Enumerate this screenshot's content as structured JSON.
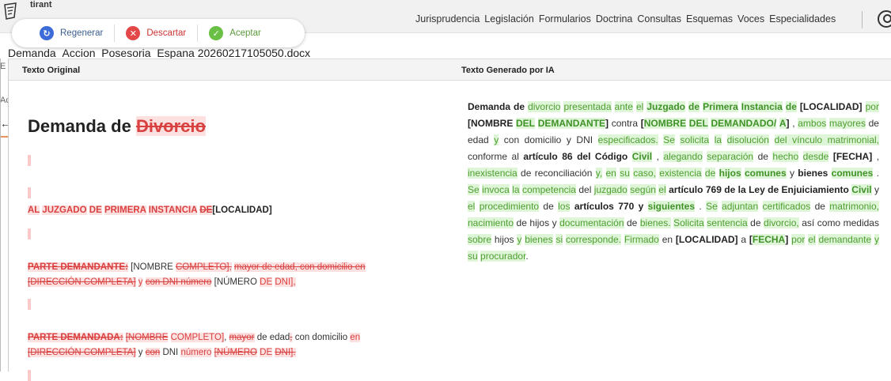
{
  "app": {
    "brand": "tirant",
    "nav": [
      "Jurisprudencia",
      "Legislación",
      "Formularios",
      "Doctrina",
      "Consultas",
      "Esquemas",
      "Voces",
      "Especialidades"
    ],
    "filename": "Demanda_Accion_Posesoria_Espana 20260217105050.docx",
    "side_fragments": [
      "E",
      "Ac"
    ]
  },
  "actions": {
    "regenerar": "Regenerar",
    "descartar": "Descartar",
    "aceptar": "Aceptar"
  },
  "compare": {
    "left_header": "Texto Original",
    "right_header": "Texto Generado por IA"
  },
  "original": {
    "title_prefix": "Demanda de ",
    "title_deleted": "Divorcio",
    "heading": {
      "deleted": [
        "AL",
        "JUZGADO",
        "DE",
        "PRIMERA",
        "INSTANCIA",
        "DE"
      ],
      "kept": "[LOCALIDAD]"
    },
    "parte_demandante": {
      "label": "PARTE DEMANDANTE:",
      "nombre": "[NOMBRE",
      "completo": "COMPLETO],",
      "mayor": "mayor de edad, con domicilio en",
      "direccion": "[DIRECCIÓN COMPLETA]",
      "y": "y",
      "con_dni": "con DNI número",
      "numero": "[NÚMERO",
      "de": "DE",
      "dni": "DNI],"
    },
    "parte_demandada": {
      "label": "PARTE DEMANDADA:",
      "nombre": "[NOMBRE",
      "completo": "COMPLETO]",
      "comma": ",",
      "mayor": "mayor",
      "de_edad": "de edad",
      "con_domicilio": "con domicilio",
      "en": "en",
      "direccion": "[DIRECCIÓN COMPLETA]",
      "y": "y",
      "con": "con",
      "dni_word": "DNI",
      "numero": "número",
      "numero2": "[NÚMERO",
      "de": "DE",
      "dni": "DNI]."
    }
  },
  "generated": {
    "text_tokens": [
      {
        "t": "Demanda de ",
        "k": "b"
      },
      {
        "t": "divorcio",
        "k": "ins"
      },
      {
        "t": " ",
        "k": "n"
      },
      {
        "t": "presentada",
        "k": "ins"
      },
      {
        "t": " ",
        "k": "n"
      },
      {
        "t": "ante",
        "k": "ins"
      },
      {
        "t": " ",
        "k": "n"
      },
      {
        "t": "el",
        "k": "ins"
      },
      {
        "t": " ",
        "k": "n"
      },
      {
        "t": "Juzgado",
        "k": "insb"
      },
      {
        "t": " ",
        "k": "n"
      },
      {
        "t": "de",
        "k": "insb"
      },
      {
        "t": " ",
        "k": "n"
      },
      {
        "t": "Primera",
        "k": "insb"
      },
      {
        "t": " ",
        "k": "n"
      },
      {
        "t": "Instancia",
        "k": "insb"
      },
      {
        "t": " ",
        "k": "n"
      },
      {
        "t": "de",
        "k": "insb"
      },
      {
        "t": " ",
        "k": "n"
      },
      {
        "t": "[LOCALIDAD]",
        "k": "b"
      },
      {
        "t": " ",
        "k": "n"
      },
      {
        "t": "por",
        "k": "ins"
      },
      {
        "t": " ",
        "k": "n"
      },
      {
        "t": "[NOMBRE",
        "k": "b"
      },
      {
        "t": " ",
        "k": "n"
      },
      {
        "t": "DEL",
        "k": "insb"
      },
      {
        "t": " ",
        "k": "n"
      },
      {
        "t": "DEMANDANTE",
        "k": "insb"
      },
      {
        "t": "]",
        "k": "b"
      },
      {
        "t": " contra ",
        "k": "n"
      },
      {
        "t": "[",
        "k": "b"
      },
      {
        "t": "NOMBRE",
        "k": "insb"
      },
      {
        "t": " ",
        "k": "n"
      },
      {
        "t": "DEL",
        "k": "insb"
      },
      {
        "t": " ",
        "k": "n"
      },
      {
        "t": "DEMANDADO/",
        "k": "insb"
      },
      {
        "t": " ",
        "k": "n"
      },
      {
        "t": "A",
        "k": "insb"
      },
      {
        "t": "]",
        "k": "b"
      },
      {
        "t": " , ",
        "k": "n"
      },
      {
        "t": "ambos",
        "k": "ins"
      },
      {
        "t": " ",
        "k": "n"
      },
      {
        "t": "mayores",
        "k": "ins"
      },
      {
        "t": " de edad ",
        "k": "n"
      },
      {
        "t": "y",
        "k": "ins"
      },
      {
        "t": " con domicilio y DNI ",
        "k": "n"
      },
      {
        "t": "especificados.",
        "k": "ins"
      },
      {
        "t": " ",
        "k": "n"
      },
      {
        "t": "Se",
        "k": "ins"
      },
      {
        "t": " ",
        "k": "n"
      },
      {
        "t": "solicita",
        "k": "ins"
      },
      {
        "t": " ",
        "k": "n"
      },
      {
        "t": "la",
        "k": "ins"
      },
      {
        "t": " ",
        "k": "n"
      },
      {
        "t": "disolución",
        "k": "ins"
      },
      {
        "t": " ",
        "k": "n"
      },
      {
        "t": "del vínculo matrimonial,",
        "k": "ins"
      },
      {
        "t": " conforme al ",
        "k": "n"
      },
      {
        "t": "artículo 86 del Código",
        "k": "b"
      },
      {
        "t": " ",
        "k": "n"
      },
      {
        "t": "Civil",
        "k": "insb"
      },
      {
        "t": " , ",
        "k": "n"
      },
      {
        "t": "alegando",
        "k": "ins"
      },
      {
        "t": " ",
        "k": "n"
      },
      {
        "t": "separación",
        "k": "ins"
      },
      {
        "t": " de ",
        "k": "n"
      },
      {
        "t": "hecho",
        "k": "ins"
      },
      {
        "t": " ",
        "k": "n"
      },
      {
        "t": "desde",
        "k": "ins"
      },
      {
        "t": " ",
        "k": "n"
      },
      {
        "t": "[FECHA]",
        "k": "b"
      },
      {
        "t": " , ",
        "k": "n"
      },
      {
        "t": "inexistencia",
        "k": "ins"
      },
      {
        "t": " de reconciliación ",
        "k": "n"
      },
      {
        "t": "y,",
        "k": "ins"
      },
      {
        "t": " ",
        "k": "n"
      },
      {
        "t": "en",
        "k": "ins"
      },
      {
        "t": " ",
        "k": "n"
      },
      {
        "t": "su",
        "k": "ins"
      },
      {
        "t": " ",
        "k": "n"
      },
      {
        "t": "caso,",
        "k": "ins"
      },
      {
        "t": " ",
        "k": "n"
      },
      {
        "t": "existencia",
        "k": "ins"
      },
      {
        "t": " ",
        "k": "n"
      },
      {
        "t": "de",
        "k": "ins"
      },
      {
        "t": " ",
        "k": "n"
      },
      {
        "t": "hijos",
        "k": "insb"
      },
      {
        "t": " ",
        "k": "n"
      },
      {
        "t": "comunes",
        "k": "insb"
      },
      {
        "t": " y ",
        "k": "n"
      },
      {
        "t": "bienes",
        "k": "b"
      },
      {
        "t": " ",
        "k": "n"
      },
      {
        "t": "comunes",
        "k": "insb"
      },
      {
        "t": " . ",
        "k": "n"
      },
      {
        "t": "Se",
        "k": "ins"
      },
      {
        "t": " ",
        "k": "n"
      },
      {
        "t": "invoca",
        "k": "ins"
      },
      {
        "t": " ",
        "k": "n"
      },
      {
        "t": "la",
        "k": "ins"
      },
      {
        "t": " ",
        "k": "n"
      },
      {
        "t": "competencia",
        "k": "ins"
      },
      {
        "t": " del ",
        "k": "n"
      },
      {
        "t": "juzgado",
        "k": "ins"
      },
      {
        "t": " ",
        "k": "n"
      },
      {
        "t": "según",
        "k": "ins"
      },
      {
        "t": " ",
        "k": "n"
      },
      {
        "t": "el",
        "k": "ins"
      },
      {
        "t": " ",
        "k": "n"
      },
      {
        "t": "artículo",
        "k": "b"
      },
      {
        "t": " ",
        "k": "n"
      },
      {
        "t": "769 de la Ley de Enjuiciamiento",
        "k": "b"
      },
      {
        "t": " ",
        "k": "n"
      },
      {
        "t": "Civil",
        "k": "insb"
      },
      {
        "t": " y ",
        "k": "n"
      },
      {
        "t": "el",
        "k": "ins"
      },
      {
        "t": " ",
        "k": "n"
      },
      {
        "t": "procedimiento",
        "k": "ins"
      },
      {
        "t": " de ",
        "k": "n"
      },
      {
        "t": "los",
        "k": "ins"
      },
      {
        "t": " ",
        "k": "n"
      },
      {
        "t": "artículos 770 y",
        "k": "b"
      },
      {
        "t": " ",
        "k": "n"
      },
      {
        "t": "siguientes",
        "k": "insb"
      },
      {
        "t": " ",
        "k": "n"
      },
      {
        "t": ". ",
        "k": "n"
      },
      {
        "t": "Se",
        "k": "ins"
      },
      {
        "t": " ",
        "k": "n"
      },
      {
        "t": "adjuntan",
        "k": "ins"
      },
      {
        "t": " ",
        "k": "n"
      },
      {
        "t": "certificados",
        "k": "ins"
      },
      {
        "t": " de ",
        "k": "n"
      },
      {
        "t": "matrimonio,",
        "k": "ins"
      },
      {
        "t": " ",
        "k": "n"
      },
      {
        "t": "nacimiento",
        "k": "ins"
      },
      {
        "t": " de hijos y ",
        "k": "n"
      },
      {
        "t": "documentación",
        "k": "ins"
      },
      {
        "t": " de ",
        "k": "n"
      },
      {
        "t": "bienes.",
        "k": "ins"
      },
      {
        "t": " ",
        "k": "n"
      },
      {
        "t": "Solicita",
        "k": "ins"
      },
      {
        "t": " ",
        "k": "n"
      },
      {
        "t": "sentencia",
        "k": "ins"
      },
      {
        "t": " de ",
        "k": "n"
      },
      {
        "t": "divorcio,",
        "k": "ins"
      },
      {
        "t": " así como medidas ",
        "k": "n"
      },
      {
        "t": "sobre",
        "k": "ins"
      },
      {
        "t": " hijos ",
        "k": "n"
      },
      {
        "t": "y",
        "k": "ins"
      },
      {
        "t": " ",
        "k": "n"
      },
      {
        "t": "bienes",
        "k": "ins"
      },
      {
        "t": " ",
        "k": "n"
      },
      {
        "t": "si",
        "k": "ins"
      },
      {
        "t": " ",
        "k": "n"
      },
      {
        "t": "corresponde.",
        "k": "ins"
      },
      {
        "t": " ",
        "k": "n"
      },
      {
        "t": "Firmado",
        "k": "ins"
      },
      {
        "t": " en ",
        "k": "n"
      },
      {
        "t": "[LOCALIDAD]",
        "k": "b"
      },
      {
        "t": "  a ",
        "k": "n"
      },
      {
        "t": "[",
        "k": "b"
      },
      {
        "t": "FECHA",
        "k": "insb"
      },
      {
        "t": "]",
        "k": "b"
      },
      {
        "t": " ",
        "k": "n"
      },
      {
        "t": "por",
        "k": "ins"
      },
      {
        "t": " ",
        "k": "n"
      },
      {
        "t": "el",
        "k": "ins"
      },
      {
        "t": " ",
        "k": "n"
      },
      {
        "t": "demandante",
        "k": "ins"
      },
      {
        "t": " ",
        "k": "n"
      },
      {
        "t": "y",
        "k": "ins"
      },
      {
        "t": " ",
        "k": "n"
      },
      {
        "t": "su",
        "k": "ins"
      },
      {
        "t": " ",
        "k": "n"
      },
      {
        "t": "procurador",
        "k": "ins"
      },
      {
        "t": ".",
        "k": "n"
      }
    ]
  }
}
